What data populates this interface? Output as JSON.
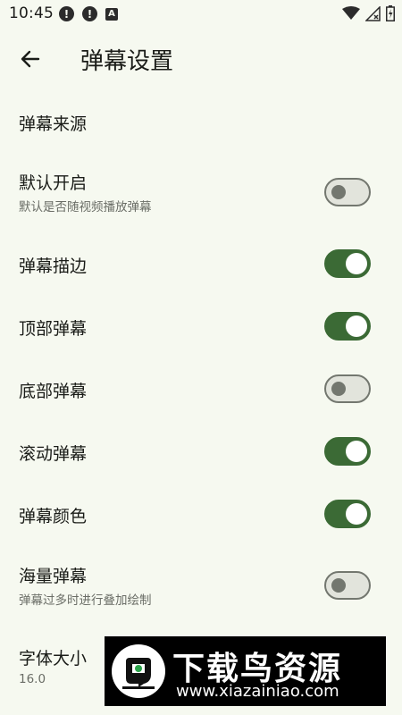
{
  "status_bar": {
    "time": "10:45",
    "left_icons": [
      "alert-icon",
      "alert-icon",
      "a-icon"
    ],
    "right_icons": [
      "wifi-icon",
      "signal-icon",
      "battery-icon"
    ]
  },
  "app_bar": {
    "back_icon": "arrow-left-icon",
    "title": "弹幕设置"
  },
  "settings": {
    "source": {
      "title": "弹幕来源"
    },
    "default_on": {
      "title": "默认开启",
      "subtitle": "默认是否随视频播放弹幕",
      "enabled": false
    },
    "stroke": {
      "title": "弹幕描边",
      "enabled": true
    },
    "top": {
      "title": "顶部弹幕",
      "enabled": true
    },
    "bottom": {
      "title": "底部弹幕",
      "enabled": false
    },
    "scroll": {
      "title": "滚动弹幕",
      "enabled": true
    },
    "color": {
      "title": "弹幕颜色",
      "enabled": true
    },
    "massive": {
      "title": "海量弹幕",
      "subtitle": "弹幕过多时进行叠加绘制",
      "enabled": false
    },
    "font_size": {
      "title": "字体大小",
      "value": "16.0"
    }
  },
  "watermark": {
    "text": "下载鸟资源",
    "url": "www.xiazainiao.com"
  },
  "colors": {
    "background": "#f6f9f0",
    "switch_on": "#3b6a35",
    "switch_off_track": "#e2e4dc",
    "switch_off_outline": "#73776f"
  }
}
